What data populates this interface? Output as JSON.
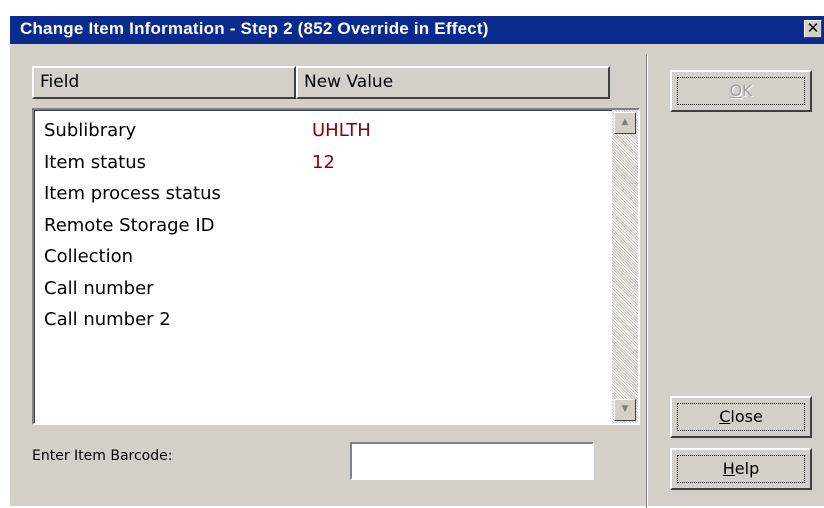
{
  "window": {
    "title": "Change Item Information - Step 2 (852 Override in Effect)",
    "close_glyph": "✕"
  },
  "table": {
    "headers": {
      "field": "Field",
      "new_value": "New Value"
    },
    "rows": [
      {
        "field": "Sublibrary",
        "value": "UHLTH"
      },
      {
        "field": "Item status",
        "value": "12"
      },
      {
        "field": "Item process status",
        "value": ""
      },
      {
        "field": "Remote Storage ID",
        "value": ""
      },
      {
        "field": "Collection",
        "value": ""
      },
      {
        "field": "Call number",
        "value": ""
      },
      {
        "field": "Call number 2",
        "value": ""
      }
    ],
    "value_color": "#8b0000"
  },
  "barcode": {
    "label": "Enter Item Barcode:",
    "value": ""
  },
  "buttons": {
    "ok": {
      "mnemonic": "O",
      "rest": "K",
      "enabled": false
    },
    "close": {
      "mnemonic": "C",
      "rest": "lose"
    },
    "help": {
      "mnemonic": "H",
      "rest": "elp"
    }
  },
  "colors": {
    "titlebar": "#0a2a8e",
    "dialog_bg": "#d4d0c8"
  }
}
